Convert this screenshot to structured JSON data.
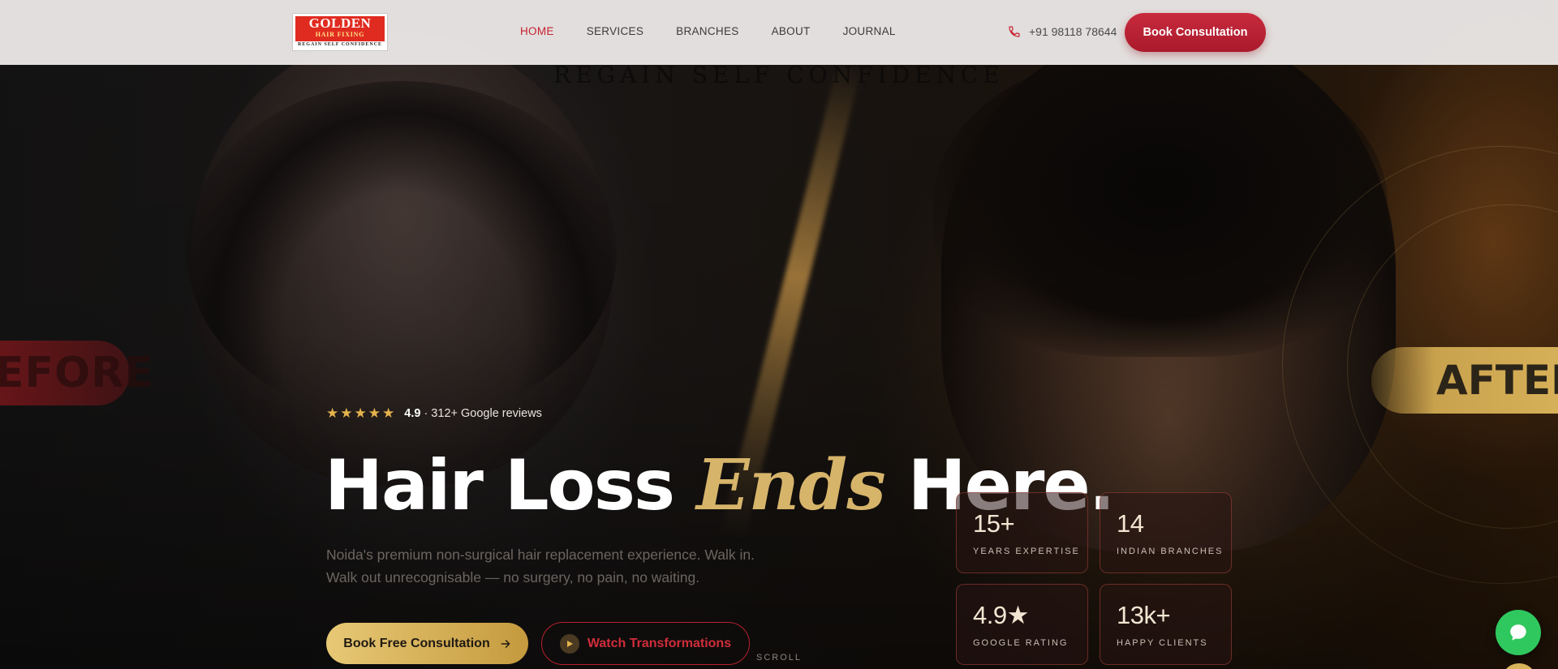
{
  "header": {
    "logo": {
      "title": "GOLDEN",
      "subtitle": "HAIR FIXING",
      "tagline": "REGAIN SELF CONFIDENCE"
    },
    "nav": [
      {
        "label": "HOME",
        "active": true
      },
      {
        "label": "SERVICES",
        "active": false
      },
      {
        "label": "BRANCHES",
        "active": false
      },
      {
        "label": "ABOUT",
        "active": false
      },
      {
        "label": "JOURNAL",
        "active": false
      }
    ],
    "phone": "+91 98118 78644",
    "cta_label": "Book Consultation"
  },
  "hero": {
    "background_tagline": "REGAIN SELF CONFIDENCE",
    "before_label": "EFORE",
    "after_label": "AFTER",
    "rating": {
      "stars": 5,
      "score": "4.9",
      "reviews": "· 312+ Google reviews"
    },
    "headline": {
      "part1": "Hair Loss",
      "accent": "Ends",
      "part2": "Here."
    },
    "subtext": "Noida's premium non-surgical hair replacement experience. Walk in. Walk out unrecognisable — no surgery, no pain, no waiting.",
    "primary_cta": "Book Free Consultation",
    "secondary_cta": "Watch Transformations",
    "scroll_label": "SCROLL"
  },
  "stats": [
    {
      "value": "15+",
      "label": "YEARS EXPERTISE"
    },
    {
      "value": "14",
      "label": "INDIAN BRANCHES"
    },
    {
      "value": "4.9★",
      "label": "GOOGLE RATING"
    },
    {
      "value": "13k+",
      "label": "HAPPY CLIENTS"
    }
  ],
  "colors": {
    "brand_red": "#c8202f",
    "gold": "#d6b46a",
    "whatsapp_green": "#2fc85e"
  },
  "icons": [
    "phone-icon",
    "star-icon",
    "arrow-right-icon",
    "play-icon",
    "chat-icon"
  ]
}
